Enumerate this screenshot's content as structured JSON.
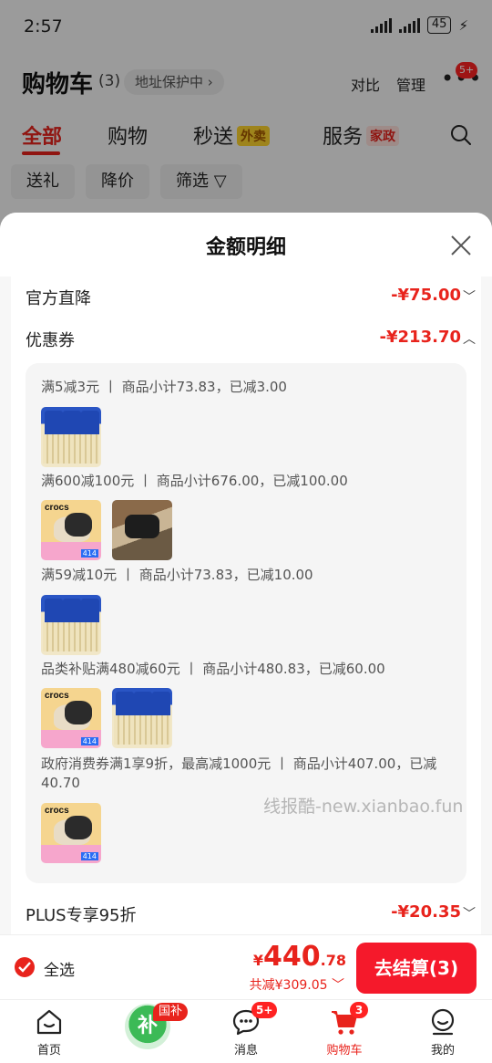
{
  "status_bar": {
    "time": "2:57",
    "battery": "45"
  },
  "header": {
    "title": "购物车",
    "count": "(3)",
    "address_label": "地址保护中",
    "compare_label": "对比",
    "manage_label": "管理",
    "more_badge": "5+"
  },
  "tabs": [
    {
      "label": "全部",
      "active": true
    },
    {
      "label": "购物"
    },
    {
      "label": "秒送",
      "tag": "外卖"
    },
    {
      "label": "服务",
      "tag": "家政"
    }
  ],
  "filters": [
    "送礼",
    "降价",
    "筛选"
  ],
  "sheet": {
    "title": "金额明细",
    "rows": [
      {
        "label": "官方直降",
        "amount": "-¥75.00",
        "chevron": "down"
      },
      {
        "label": "优惠券",
        "amount": "-¥213.70",
        "chevron": "up"
      }
    ],
    "coupons": [
      {
        "text": "满5减3元 丨 商品小计73.83，已减3.00",
        "thumbs": [
          "snack"
        ]
      },
      {
        "text": "满600减100元 丨 商品小计676.00，已减100.00",
        "thumbs": [
          "shoe",
          "photo"
        ]
      },
      {
        "text": "满59减10元 丨 商品小计73.83，已减10.00",
        "thumbs": [
          "snack"
        ]
      },
      {
        "text": "品类补贴满480减60元 丨 商品小计480.83，已减60.00",
        "thumbs": [
          "shoe",
          "snack"
        ]
      },
      {
        "text": "政府消费券满1享9折，最高减1000元 丨 商品小计407.00，已减40.70",
        "thumbs": [
          "shoe"
        ]
      }
    ],
    "plus_row": {
      "label": "PLUS专享95折",
      "amount": "-¥20.35",
      "chevron": "down"
    },
    "watermark": "线报酷-new.xianbao.fun"
  },
  "action_bar": {
    "select_all_label": "全选",
    "currency": "¥",
    "total_int": "440",
    "total_dec": ".78",
    "saved_label": "共减¥309.05",
    "checkout_label": "去结算(3)"
  },
  "tabbar": [
    {
      "label": "首页",
      "icon": "home-icon"
    },
    {
      "label": "",
      "icon": "subsidy-icon",
      "tag": "国补",
      "glyph": "补"
    },
    {
      "label": "消息",
      "icon": "message-icon",
      "badge": "5+"
    },
    {
      "label": "购物车",
      "icon": "cart-icon",
      "badge": "3",
      "active": true
    },
    {
      "label": "我的",
      "icon": "profile-icon"
    }
  ],
  "colors": {
    "accent": "#e8231c",
    "checkout": "#f5192b",
    "tag_yellow": "#ffd52e"
  }
}
